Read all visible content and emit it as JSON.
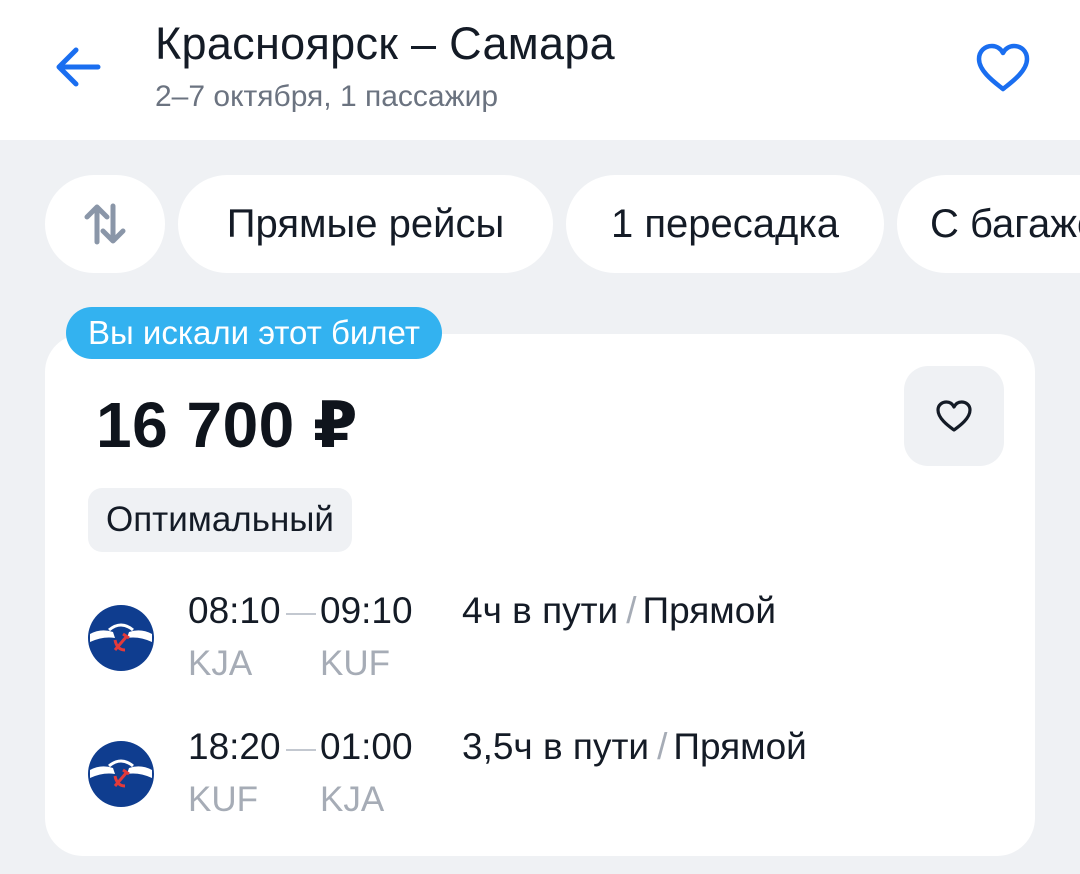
{
  "header": {
    "title": "Красноярск – Самара",
    "subtitle": "2–7 октября, 1 пассажир",
    "back_icon": "arrow-left-icon",
    "favorite_icon": "heart-outline-icon",
    "accent_color": "#1a6ef0"
  },
  "filters": {
    "sort_icon": "sort-arrows-icon",
    "chips": [
      "Прямые рейсы",
      "1 пересадка",
      "С багажом"
    ]
  },
  "ticket": {
    "badge": "Вы искали этот билет",
    "badge_color": "#33b2f0",
    "price": "16 700 ₽",
    "favorite_icon": "heart-outline-icon",
    "tag": "Оптимальный",
    "segments": [
      {
        "airline_icon": "aeroflot-logo-icon",
        "dep_time": "08:10",
        "arr_time": "09:10",
        "dep_code": "KJA",
        "arr_code": "KUF",
        "duration": "4ч в пути",
        "type": "Прямой"
      },
      {
        "airline_icon": "aeroflot-logo-icon",
        "dep_time": "18:20",
        "arr_time": "01:00",
        "dep_code": "KUF",
        "arr_code": "KJA",
        "duration": "3,5ч в пути",
        "type": "Прямой"
      }
    ]
  }
}
